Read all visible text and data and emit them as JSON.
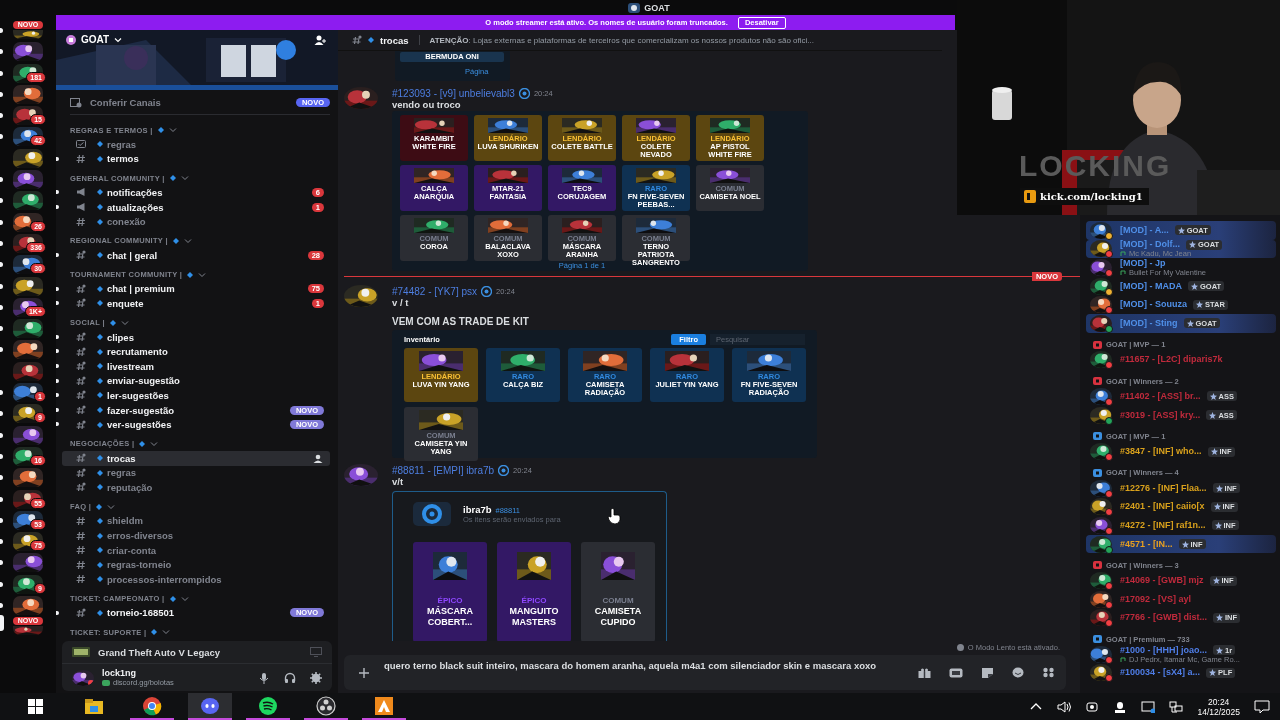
{
  "title_bar": {
    "title": "GOAT"
  },
  "streamer_banner": {
    "message": "O modo streamer está ativo. Os nomes de usuário foram truncados.",
    "button": "Desativar"
  },
  "servers": [
    {
      "badge": "NOVO",
      "unread": true,
      "selected": false
    },
    {
      "unread": true,
      "selected": false
    },
    {
      "badge": "181",
      "unread": true,
      "selected": false
    },
    {
      "unread": true,
      "selected": false
    },
    {
      "badge": "15",
      "unread": true,
      "selected": false
    },
    {
      "badge": "42",
      "unread": true,
      "selected": false
    },
    {
      "unread": false,
      "selected": false
    },
    {
      "unread": true,
      "selected": false
    },
    {
      "unread": true,
      "selected": false
    },
    {
      "badge": "26",
      "unread": true,
      "selected": false
    },
    {
      "badge": "336",
      "unread": true,
      "selected": false
    },
    {
      "badge": "30",
      "unread": true,
      "selected": false
    },
    {
      "unread": true,
      "selected": false
    },
    {
      "badge": "1K+",
      "unread": true,
      "selected": false
    },
    {
      "unread": true,
      "selected": false
    },
    {
      "unread": true,
      "selected": false
    },
    {
      "unread": false,
      "selected": false
    },
    {
      "badge": "1",
      "unread": true,
      "selected": false
    },
    {
      "badge": "9",
      "unread": true,
      "selected": false
    },
    {
      "unread": true,
      "selected": false
    },
    {
      "badge": "16",
      "unread": true,
      "selected": false
    },
    {
      "unread": true,
      "selected": false
    },
    {
      "badge": "55",
      "unread": true,
      "selected": false
    },
    {
      "badge": "53",
      "unread": true,
      "selected": false
    },
    {
      "badge": "75",
      "unread": true,
      "selected": false
    },
    {
      "unread": true,
      "selected": false
    },
    {
      "badge": "9",
      "unread": true,
      "selected": false
    },
    {
      "unread": true,
      "selected": false
    },
    {
      "badge": "NOVO",
      "unread": false,
      "selected": true
    }
  ],
  "server_header": {
    "name": "GOAT"
  },
  "browse": {
    "label": "Conferir Canais",
    "badge": "NOVO"
  },
  "categories": [
    {
      "name": "REGRAS E TERMOS |",
      "channels": [
        {
          "kind": "forum",
          "name": "regras",
          "unread": false,
          "selected": false
        },
        {
          "kind": "text",
          "name": "termos",
          "unread": true,
          "selected": false
        }
      ]
    },
    {
      "name": "GENERAL COMMUNITY |",
      "channels": [
        {
          "kind": "announcement",
          "name": "notificações",
          "unread": true,
          "selected": false,
          "mentions": "6"
        },
        {
          "kind": "announcement",
          "name": "atualizações",
          "unread": true,
          "selected": false,
          "mentions": "1"
        },
        {
          "kind": "text",
          "name": "conexão",
          "unread": false,
          "selected": false
        }
      ]
    },
    {
      "name": "REGIONAL COMMUNITY |",
      "channels": [
        {
          "kind": "thread",
          "name": "chat | geral",
          "unread": true,
          "selected": false,
          "mentions": "28"
        }
      ]
    },
    {
      "name": "TOURNAMENT COMMUNITY |",
      "channels": [
        {
          "kind": "thread",
          "name": "chat | premium",
          "unread": true,
          "selected": false,
          "mentions": "75"
        },
        {
          "kind": "thread",
          "name": "enquete",
          "unread": true,
          "selected": false,
          "mentions": "1"
        }
      ]
    },
    {
      "name": "SOCIAL |",
      "channels": [
        {
          "kind": "thread",
          "name": "clipes",
          "unread": true,
          "selected": false
        },
        {
          "kind": "thread",
          "name": "recrutamento",
          "unread": true,
          "selected": false
        },
        {
          "kind": "thread",
          "name": "livestream",
          "unread": true,
          "selected": false
        },
        {
          "kind": "thread",
          "name": "enviar-sugestão",
          "unread": true,
          "selected": false
        },
        {
          "kind": "thread",
          "name": "ler-sugestões",
          "unread": true,
          "selected": false
        },
        {
          "kind": "thread",
          "name": "fazer-sugestão",
          "unread": true,
          "selected": false,
          "new_badge": "NOVO"
        },
        {
          "kind": "thread",
          "name": "ver-sugestões",
          "unread": true,
          "selected": false,
          "new_badge": "NOVO"
        }
      ]
    },
    {
      "name": "NEGOCIAÇÕES |",
      "channels": [
        {
          "kind": "thread",
          "name": "trocas",
          "unread": false,
          "selected": true
        },
        {
          "kind": "thread",
          "name": "regras",
          "unread": false,
          "selected": false
        },
        {
          "kind": "thread",
          "name": "reputação",
          "unread": false,
          "selected": false
        }
      ]
    },
    {
      "name": "FAQ |",
      "channels": [
        {
          "kind": "text",
          "name": "shieldm",
          "unread": false,
          "selected": false
        },
        {
          "kind": "text",
          "name": "erros-diversos",
          "unread": false,
          "selected": false
        },
        {
          "kind": "text",
          "name": "criar-conta",
          "unread": false,
          "selected": false
        },
        {
          "kind": "text",
          "name": "regras-torneio",
          "unread": false,
          "selected": false
        },
        {
          "kind": "text",
          "name": "processos-interrompidos",
          "unread": false,
          "selected": false
        }
      ]
    },
    {
      "name": "TICKET: CAMPEONATO |",
      "channels": [
        {
          "kind": "thread",
          "name": "torneio-168501",
          "unread": true,
          "selected": false,
          "new_badge": "NOVO"
        }
      ]
    },
    {
      "name": "TICKET: SUPORTE |"
    }
  ],
  "user_panel": {
    "activity": "Grand Theft Auto V Legacy",
    "username": "lock1ng",
    "status_text": "discord.gg/bolotas"
  },
  "channel_header": {
    "name": "trocas",
    "topic": "**ATENÇÃO**: Lojas externas e plataformas de terceiros que comercializam os nossos produtos não são ofici..."
  },
  "messages": [
    {
      "kind": "embed_tail",
      "card": "BERMUDA ONI",
      "pager": "Página"
    },
    {
      "kind": "message",
      "author": "#123093 - [v9] unbelievabl3",
      "time": "20:24",
      "lines": [
        "vendo ou troco"
      ],
      "attachment": {
        "kind": "grid",
        "footer": "Página 1 de 1",
        "items": [
          {
            "color": "#3d0c14",
            "name": "KARAMBIT WHITE FIRE"
          },
          {
            "color": "#5c4610",
            "rarity": "LENDÁRIO",
            "name": "LUVA SHURIKEN"
          },
          {
            "color": "#5c4610",
            "rarity": "LENDÁRIO",
            "name": "COLETE BATTLE"
          },
          {
            "color": "#5c4610",
            "rarity": "LENDÁRIO",
            "name": "COLETE NEVADO"
          },
          {
            "color": "#5c4610",
            "rarity": "LENDÁRIO",
            "name": "AP PISTOL WHITE FIRE"
          },
          {
            "color": "#331865",
            "name": "CALÇA ANARQUIA"
          },
          {
            "color": "#331865",
            "name": "MTAR-21 FANTASIA"
          },
          {
            "color": "#331865",
            "name": "TEC9 CORUJAGEM"
          },
          {
            "color": "#0f3152",
            "rarity": "RARO",
            "name": "FN FIVE-SEVEN PEEBAS..."
          },
          {
            "color": "#2b2d33",
            "rarity": "COMUM",
            "name": "CAMISETA NOEL"
          },
          {
            "color": "#2b2d33",
            "rarity": "COMUM",
            "name": "COROA"
          },
          {
            "color": "#2b2d33",
            "rarity": "COMUM",
            "name": "BALACLAVA XOXO"
          },
          {
            "color": "#2b2d33",
            "rarity": "COMUM",
            "name": "MÁSCARA ARANHA"
          },
          {
            "color": "#2b2d33",
            "rarity": "COMUM",
            "name": "TERNO PATRIOTA SANGRENTO"
          }
        ]
      }
    },
    {
      "kind": "divider",
      "label": "NOVO"
    },
    {
      "kind": "message",
      "author": "#74482 - [YK7] psx",
      "time": "20:24",
      "lines": [
        "v / t",
        "VEM COM AS TRADE DE KIT"
      ],
      "attachment": {
        "kind": "inventory",
        "title": "Inventário",
        "button": "Filtro",
        "placeholder": "Pesquisar",
        "items": [
          {
            "color": "#5c4610",
            "rarity": "LENDÁRIO",
            "name": "LUVA YIN YANG"
          },
          {
            "color": "#0f3152",
            "rarity": "RARO",
            "name": "CALÇA BIZ"
          },
          {
            "color": "#0f3152",
            "rarity": "RARO",
            "name": "CAMISETA RADIAÇÃO"
          },
          {
            "color": "#0f3152",
            "rarity": "RARO",
            "name": "JULIET YIN YANG"
          },
          {
            "color": "#0f3152",
            "rarity": "RARO",
            "name": "FN FIVE-SEVEN RADIAÇÃO"
          },
          {
            "color": "#2b2d33",
            "rarity": "COMUM",
            "name": "CAMISETA YIN YANG"
          }
        ]
      }
    },
    {
      "kind": "message",
      "author": "#88811 - [EMPI] ibra7b",
      "time": "20:24",
      "lines": [
        "v/t"
      ],
      "attachment": {
        "kind": "trade",
        "user": "ibra7b",
        "tag": "#88811",
        "subtitle": "Os itens serão enviados para",
        "items": [
          {
            "color": "#331865",
            "rarity": "ÉPICO",
            "name": "MÁSCARA COBERT..."
          },
          {
            "color": "#331865",
            "rarity": "ÉPICO",
            "name": "MANGUITO MASTERS"
          },
          {
            "color": "#2b2d33",
            "rarity": "COMUM",
            "name": "CAMISETA CUPIDO"
          }
        ]
      }
    }
  ],
  "slow_mode": "O Modo Lento está ativado.",
  "composer": {
    "value": "quero terno black suit inteiro, mascara do homem aranha, aquela m4a1 com silenciador skin e mascara xoxo"
  },
  "webcam": {
    "overlay_title": "LOCKING",
    "link": "kick.com/locking1"
  },
  "member_groups": [
    {
      "members": [
        {
          "name": "[MOD] - A...",
          "tag": "GOAT",
          "status": {
            "color": "#f0b232"
          },
          "highlighted": true,
          "color": "#4f8fe8"
        },
        {
          "name": "[MOD] - Dolf...",
          "tag": "GOAT",
          "status": {
            "color": "#f23f43"
          },
          "highlighted": true,
          "color": "#4f8fe8",
          "activity": "Mc Kadu, Mc Jean"
        },
        {
          "name": "[MOD] - Jp",
          "status": {
            "color": "#f23f43"
          },
          "highlighted": false,
          "color": "#4f8fe8",
          "activity": "Bullet For My Valentine"
        },
        {
          "name": "[MOD] - MADA",
          "tag": "GOAT",
          "status": {
            "color": "#f0b232"
          },
          "highlighted": false,
          "color": "#4f8fe8"
        },
        {
          "name": "[MOD] - Souuza",
          "tag": "STAR",
          "status": {
            "color": "#f23f43"
          },
          "highlighted": false,
          "color": "#4f8fe8"
        },
        {
          "name": "[MOD] - Sting",
          "tag": "GOAT",
          "status": {
            "color": "#23a55a"
          },
          "highlighted": true,
          "color": "#4f8fe8"
        }
      ]
    },
    {
      "name": "GOAT | MVP — 1",
      "color": "#d8323f",
      "members": [
        {
          "name": "#11657 - [L2C] diparis7k",
          "status": {
            "color": "#f23f43"
          },
          "highlighted": false,
          "color": "#c02a3c"
        }
      ]
    },
    {
      "name": "GOAT | Winners — 2",
      "color": "#d8323f",
      "members": [
        {
          "name": "#11402 - [ASS] br...",
          "tag": "ASS",
          "status": {
            "color": "#f23f43"
          },
          "highlighted": false,
          "color": "#c02a3c"
        },
        {
          "name": "#3019 - [ASS] kry...",
          "tag": "ASS",
          "status": {
            "color": "#23a55a"
          },
          "highlighted": false,
          "color": "#c02a3c"
        }
      ]
    },
    {
      "name": "GOAT | MVP — 1",
      "color": "#3b8fe0",
      "members": [
        {
          "name": "#3847 - [INF] who...",
          "tag": "INF",
          "status": {
            "color": "#f23f43"
          },
          "highlighted": false,
          "color": "#d9a11c"
        }
      ]
    },
    {
      "name": "GOAT | Winners — 4",
      "color": "#3b8fe0",
      "members": [
        {
          "name": "#12276 - [INF] Flaa...",
          "tag": "INF",
          "status": {
            "color": "#f23f43"
          },
          "highlighted": false,
          "color": "#d9a11c"
        },
        {
          "name": "#2401 - [INF] caiio[x",
          "tag": "INF",
          "status": {
            "color": "#f23f43"
          },
          "highlighted": false,
          "color": "#d9a11c"
        },
        {
          "name": "#4272 - [INF] raf1n...",
          "tag": "INF",
          "status": {
            "color": "#f23f43"
          },
          "highlighted": false,
          "color": "#d9a11c"
        },
        {
          "name": "#4571 - [IN...",
          "tag": "INF",
          "status": {
            "color": "#23a55a"
          },
          "highlighted": true,
          "color": "#e8a020"
        }
      ]
    },
    {
      "name": "GOAT | Winners — 3",
      "color": "#d8323f",
      "members": [
        {
          "name": "#14069 - [GWB] mjz",
          "tag": "INF",
          "status": {
            "color": "#f23f43"
          },
          "highlighted": false,
          "color": "#c02a3c"
        },
        {
          "name": "#17092 - [VS] ayl",
          "status": {
            "color": "#f23f43"
          },
          "highlighted": false,
          "color": "#c02a3c"
        },
        {
          "name": "#7766 - [GWB] dist...",
          "tag": "INF",
          "status": {
            "color": "#f23f43"
          },
          "highlighted": false,
          "color": "#c02a3c"
        }
      ]
    },
    {
      "name": "GOAT | Premium — 733",
      "color": "#3b8fe0",
      "members": [
        {
          "name": "#1000 - [HHH] joao...",
          "tag": "1r",
          "status": {
            "color": "#f23f43"
          },
          "highlighted": false,
          "color": "#4f7ee8",
          "activity": "DJ Pedrx, Itamar Mc, Game Ro..."
        },
        {
          "name": "#100034 - [sX4] a...",
          "tag": "PLF",
          "status": {
            "color": "#f23f43"
          },
          "highlighted": false,
          "color": "#4f7ee8"
        }
      ]
    }
  ],
  "taskbar": {
    "apps": [
      {
        "kind": "start",
        "selected": false,
        "running": false
      },
      {
        "kind": "folder",
        "selected": false,
        "running": false
      },
      {
        "kind": "chrome",
        "selected": false,
        "running": true
      },
      {
        "kind": "discord",
        "selected": true,
        "running": true
      },
      {
        "kind": "spotify",
        "selected": false,
        "running": true
      },
      {
        "kind": "obs",
        "selected": false,
        "running": true
      },
      {
        "kind": "orange",
        "selected": false,
        "running": true
      }
    ],
    "time": "20:24",
    "date": "14/12/2025"
  }
}
